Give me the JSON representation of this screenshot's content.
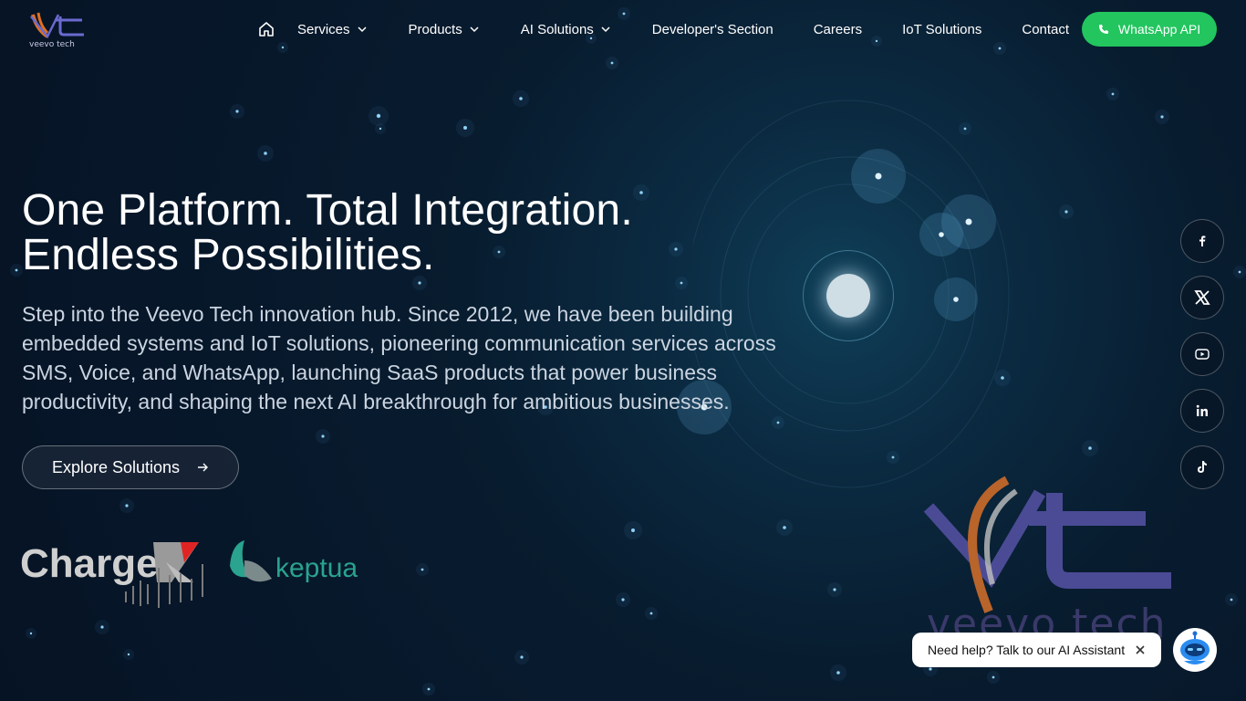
{
  "brand": {
    "name": "veevo tech",
    "accent_orange": "#e07020",
    "accent_purple": "#5a5aa8"
  },
  "header": {
    "home_icon": "home-icon",
    "nav": [
      {
        "label": "Services",
        "has_dropdown": true
      },
      {
        "label": "Products",
        "has_dropdown": true
      },
      {
        "label": "AI Solutions",
        "has_dropdown": true
      },
      {
        "label": "Developer's Section",
        "has_dropdown": false
      },
      {
        "label": "Careers",
        "has_dropdown": false
      },
      {
        "label": "IoT Solutions",
        "has_dropdown": false
      },
      {
        "label": "Contact",
        "has_dropdown": false
      }
    ],
    "cta": {
      "label": "WhatsApp API",
      "icon": "phone-icon",
      "color": "#22c55e"
    }
  },
  "hero": {
    "title_line1": "One Platform. Total Integration.",
    "title_line2": "Endless Possibilities.",
    "description": "Step into the Veevo Tech innovation hub. Since 2012, we have been building embedded systems and IoT solutions, pioneering communication services across SMS, Voice, and WhatsApp, launching SaaS products that power business productivity, and shaping the next AI breakthrough for ambitious businesses.",
    "cta_label": "Explore Solutions"
  },
  "partners": [
    {
      "name": "ChargeX",
      "text": "Charge"
    },
    {
      "name": "keptua",
      "text": "keptua"
    }
  ],
  "social": [
    "facebook-icon",
    "x-icon",
    "youtube-icon",
    "linkedin-icon",
    "tiktok-icon"
  ],
  "chat": {
    "label": "Need help? Talk to our AI Assistant"
  }
}
